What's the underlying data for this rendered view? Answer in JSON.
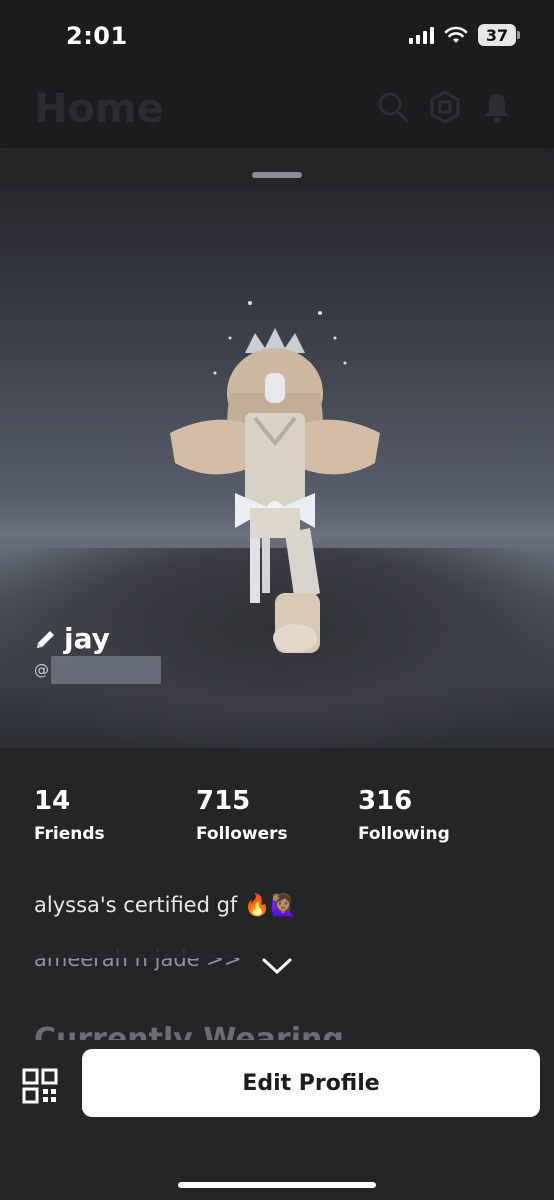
{
  "status_bar": {
    "time": "2:01",
    "battery": "37",
    "icons": [
      "cellular-signal-icon",
      "wifi-icon",
      "battery-icon"
    ]
  },
  "header": {
    "title": "Home",
    "icons": [
      "search-icon",
      "robux-icon",
      "bell-icon"
    ]
  },
  "profile": {
    "display_name": "jay",
    "username_prefix": "@",
    "edit_icon": "pencil-icon"
  },
  "stats": [
    {
      "value": "14",
      "label": "Friends"
    },
    {
      "value": "715",
      "label": "Followers"
    },
    {
      "value": "316",
      "label": "Following"
    }
  ],
  "bio": {
    "line1": "alyssa's certified gf 🔥🙋🏽‍♀️",
    "line2": "ameerah n jade >>"
  },
  "sections": {
    "currently_wearing": "Currently Wearing"
  },
  "actions": {
    "edit_profile_label": "Edit Profile",
    "qr_icon": "qr-code-icon"
  },
  "colors": {
    "background": "#232527",
    "button": "#ffffff",
    "button_text": "#1b1c1e"
  }
}
